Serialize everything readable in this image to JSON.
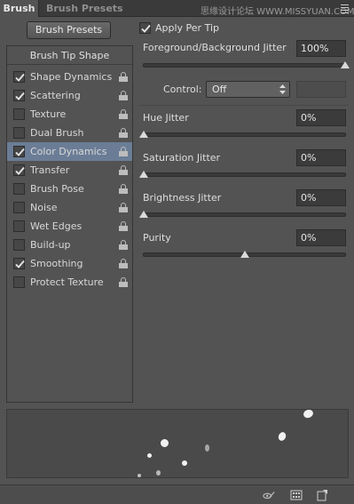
{
  "tabs": [
    {
      "label": "Brush",
      "active": true
    },
    {
      "label": "Brush Presets",
      "active": false
    }
  ],
  "watermark": "思缘设计论坛  WWW.MISSYUAN.COM",
  "brush_presets_button": "Brush Presets",
  "list": {
    "title": "Brush Tip Shape",
    "items": [
      {
        "label": "Shape Dynamics",
        "checked": true
      },
      {
        "label": "Scattering",
        "checked": true
      },
      {
        "label": "Texture",
        "checked": false
      },
      {
        "label": "Dual Brush",
        "checked": false
      },
      {
        "label": "Color Dynamics",
        "checked": true,
        "selected": true
      },
      {
        "label": "Transfer",
        "checked": true
      },
      {
        "label": "Brush Pose",
        "checked": false
      },
      {
        "label": "Noise",
        "checked": false
      },
      {
        "label": "Wet Edges",
        "checked": false
      },
      {
        "label": "Build-up",
        "checked": false
      },
      {
        "label": "Smoothing",
        "checked": true
      },
      {
        "label": "Protect Texture",
        "checked": false
      }
    ]
  },
  "apply_per_tip": {
    "label": "Apply Per Tip",
    "checked": true
  },
  "fg_bg_jitter": {
    "label": "Foreground/Background Jitter",
    "value": "100%",
    "level": 1.0
  },
  "control": {
    "label": "Control:",
    "selected": "Off"
  },
  "hue_jitter": {
    "label": "Hue Jitter",
    "value": "0%",
    "level": 0.0
  },
  "saturation_jitter": {
    "label": "Saturation Jitter",
    "value": "0%",
    "level": 0.0
  },
  "brightness_jitter": {
    "label": "Brightness Jitter",
    "value": "0%",
    "level": 0.0
  },
  "purity": {
    "label": "Purity",
    "value": "0%",
    "level": 0.5
  },
  "colors": {
    "panel": "#535353",
    "selection": "#6b7d96",
    "field": "#3b3b3b"
  },
  "icons": {
    "lock": "lock-icon",
    "bottom": [
      "toggle-live-tip-preview-icon",
      "open-preset-manager-icon",
      "create-new-brush-icon"
    ]
  }
}
